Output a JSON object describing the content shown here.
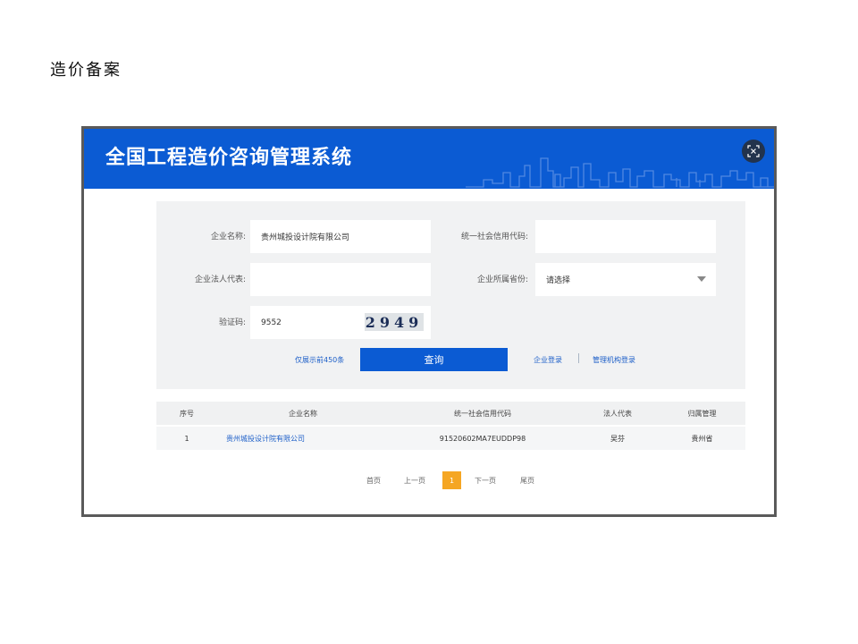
{
  "doc_heading": "造价备案",
  "banner": {
    "title": "全国工程造价咨询管理系统",
    "accent": "#0b5bd3"
  },
  "scan_icon": "scan-frame-icon",
  "form": {
    "company_name_label": "企业名称:",
    "company_name_value": "贵州城投设计院有限公司",
    "credit_code_label": "统一社会信用代码:",
    "credit_code_value": "",
    "legal_rep_label": "企业法人代表:",
    "legal_rep_value": "",
    "province_label": "企业所属省份:",
    "province_value": "请选择",
    "captcha_label": "验证码:",
    "captcha_value": "9552",
    "captcha_image_text": "2949",
    "limit_note": "仅展示前450条",
    "query_button": "查询",
    "company_login": "企业登录",
    "agency_login": "管理机构登录"
  },
  "table": {
    "headers": [
      "序号",
      "企业名称",
      "统一社会信用代码",
      "法人代表",
      "归属管理"
    ],
    "rows": [
      [
        "1",
        "贵州城投设计院有限公司",
        "91520602MA7EUDDP98",
        "吴芬",
        "贵州省"
      ]
    ]
  },
  "pagination": {
    "first": "首页",
    "prev": "上一页",
    "current": "1",
    "next": "下一页",
    "last": "尾页",
    "current_color": "#f5a623"
  }
}
